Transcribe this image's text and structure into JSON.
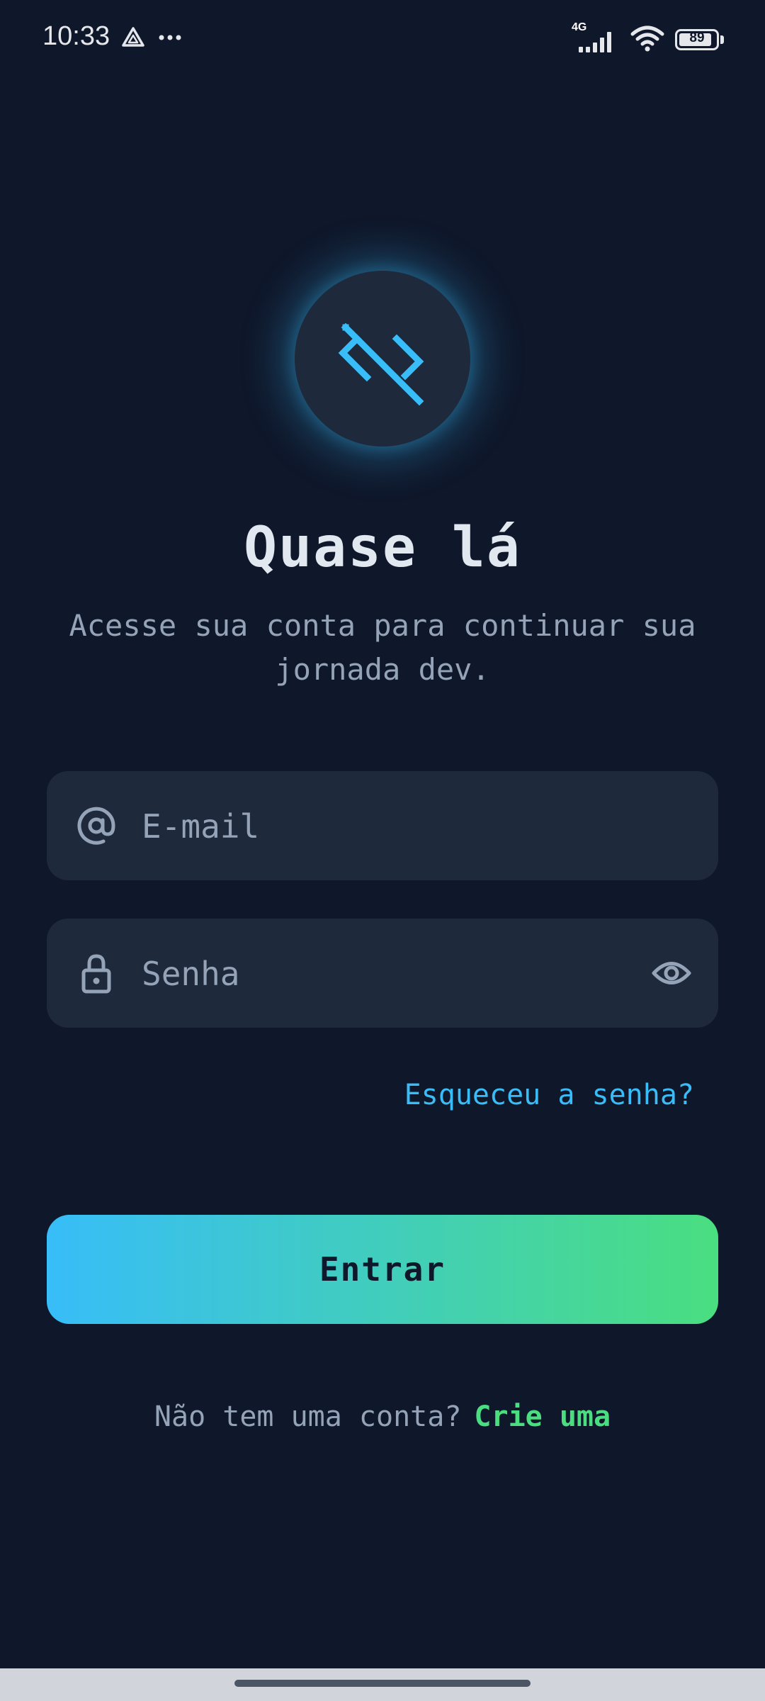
{
  "status_bar": {
    "time": "10:33",
    "network": "4G",
    "battery": "89",
    "battery_level": 0.89,
    "icons": [
      "drive-icon",
      "more-icon",
      "signal-icon",
      "wifi-icon",
      "battery-icon"
    ]
  },
  "logo": {
    "icon": "code-logo-icon",
    "accent": "#38bdf8"
  },
  "title": "Quase lá",
  "subtitle": "Acesse sua conta para continuar sua jornada dev.",
  "form": {
    "email": {
      "placeholder": "E-mail",
      "value": "",
      "icon": "at-icon"
    },
    "password": {
      "placeholder": "Senha",
      "value": "",
      "icon": "lock-icon",
      "toggle_icon": "eye-icon"
    },
    "forgot_label": "Esqueceu a senha?",
    "submit_label": "Entrar"
  },
  "signup": {
    "prompt": "Não tem uma conta?",
    "link_label": "Crie uma"
  },
  "colors": {
    "background": "#0f172a",
    "surface": "#1e293b",
    "accent_blue": "#38bdf8",
    "accent_green": "#4ade80",
    "text_muted": "#94a3b8",
    "text_primary": "#e2e8f0"
  }
}
